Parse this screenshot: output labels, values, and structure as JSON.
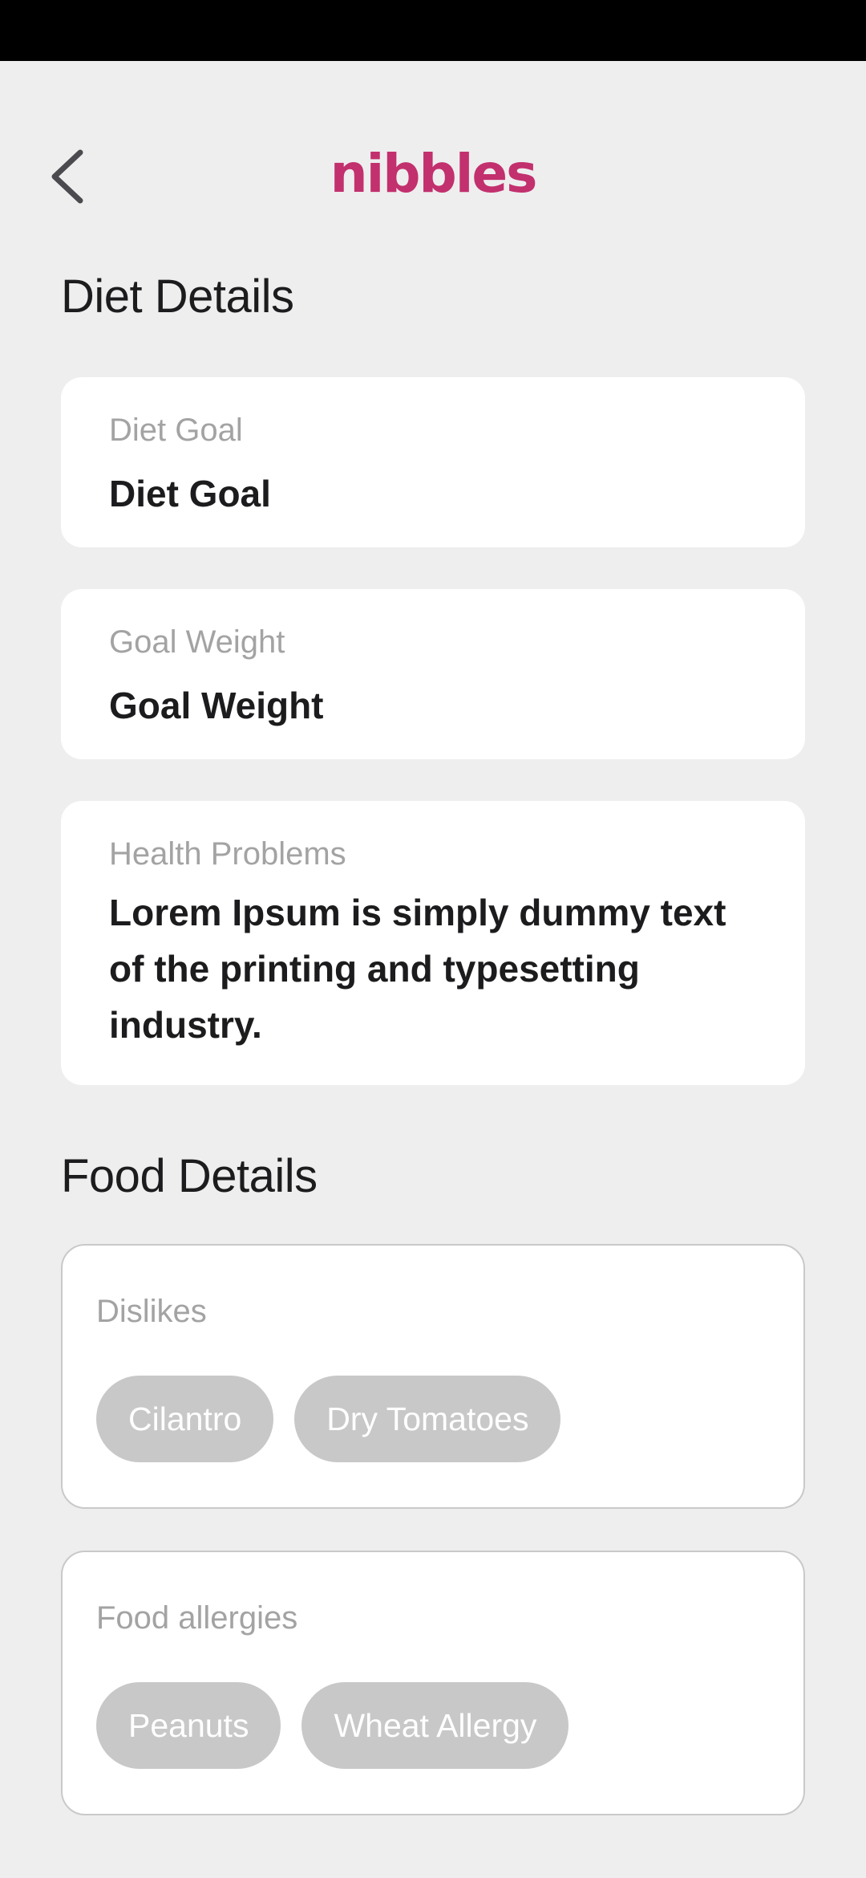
{
  "header": {
    "logo_text": "nibbles",
    "back_icon": "chevron-left-icon",
    "brand_color": "#c2306e"
  },
  "diet_section": {
    "title": "Diet Details",
    "diet_goal": {
      "label": "Diet Goal",
      "value": "Diet Goal"
    },
    "goal_weight": {
      "label": "Goal Weight",
      "value": "Goal Weight"
    },
    "health_problems": {
      "label": "Health Problems",
      "value": "Lorem Ipsum is simply dummy text of the printing and typesetting industry."
    }
  },
  "food_section": {
    "title": "Food Details",
    "dislikes": {
      "label": "Dislikes",
      "chips": [
        "Cilantro",
        "Dry Tomatoes"
      ]
    },
    "allergies": {
      "label": "Food allergies",
      "chips": [
        "Peanuts",
        "Wheat Allergy"
      ]
    }
  },
  "colors": {
    "background": "#eeeeee",
    "card": "#ffffff",
    "chip": "#c8c8c8",
    "label": "#a3a3a3"
  }
}
